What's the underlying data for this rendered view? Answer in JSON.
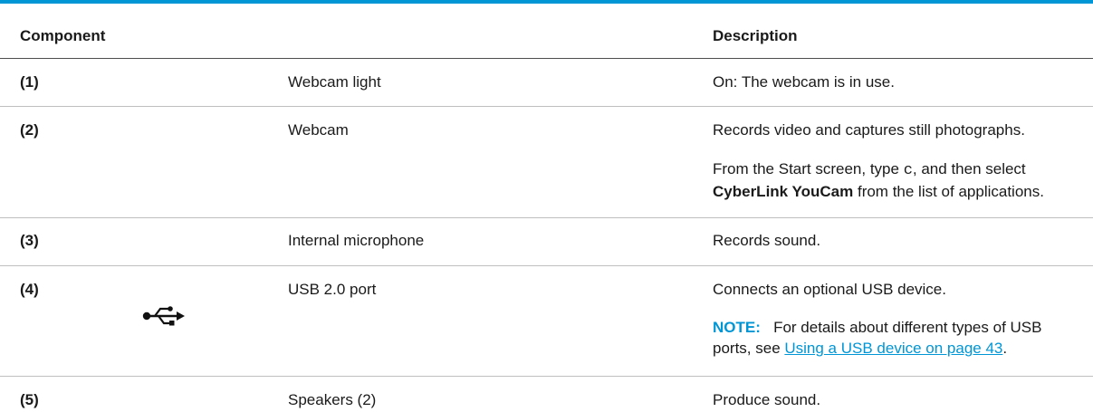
{
  "header": {
    "component": "Component",
    "description": "Description"
  },
  "rows": [
    {
      "number": "(1)",
      "name": "Webcam light",
      "desc": "On: The webcam is in use."
    },
    {
      "number": "(2)",
      "name": "Webcam",
      "desc": "Records video and captures still photographs.",
      "desc2_part1": "From the Start screen, type ",
      "desc2_code": "c",
      "desc2_part2": ", and then select",
      "desc2_bold": "CyberLink YouCam",
      "desc2_part3": " from the list of applications."
    },
    {
      "number": "(3)",
      "name": "Internal microphone",
      "desc": "Records sound."
    },
    {
      "number": "(4)",
      "icon": "usb-icon",
      "name": "USB 2.0 port",
      "desc": "Connects an optional USB device.",
      "note_label": "NOTE:",
      "note_text": "For details about different types of USB",
      "note_text2": "ports, see ",
      "note_link": "Using a USB device on page 43",
      "note_end": "."
    },
    {
      "number": "(5)",
      "name": "Speakers (2)",
      "desc": "Produce sound."
    }
  ],
  "colors": {
    "accent": "#0096d6",
    "text": "#1a1a1a",
    "rule": "#bfbfbf"
  }
}
